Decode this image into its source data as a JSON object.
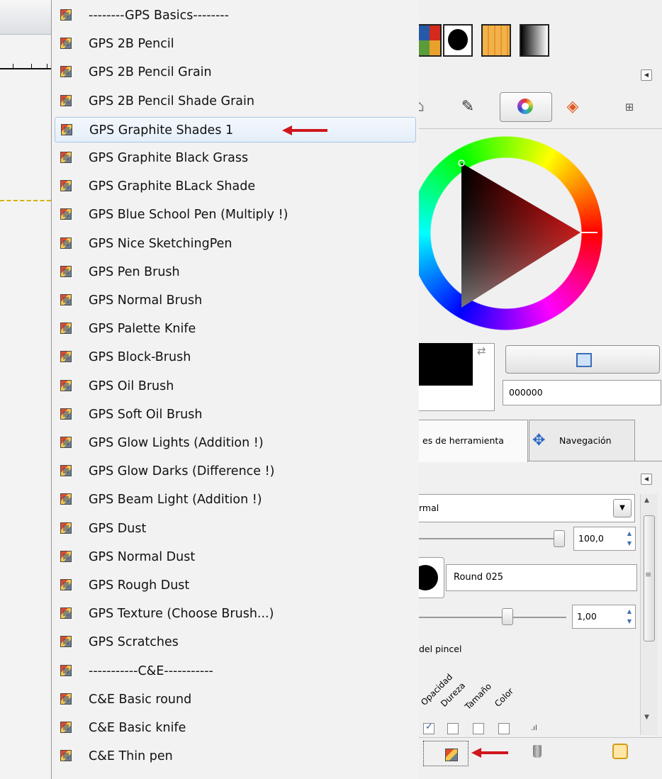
{
  "brush_menu": {
    "items": [
      {
        "label": "--------GPS Basics--------",
        "highlighted": false
      },
      {
        "label": "GPS 2B Pencil",
        "highlighted": false
      },
      {
        "label": "GPS 2B Pencil Grain",
        "highlighted": false
      },
      {
        "label": "GPS 2B Pencil Shade Grain",
        "highlighted": false
      },
      {
        "label": "GPS Graphite Shades 1",
        "highlighted": true
      },
      {
        "label": "GPS Graphite Black Grass",
        "highlighted": false
      },
      {
        "label": "GPS Graphite BLack Shade",
        "highlighted": false
      },
      {
        "label": "GPS Blue School Pen (Multiply !)",
        "highlighted": false
      },
      {
        "label": "GPS Nice SketchingPen",
        "highlighted": false
      },
      {
        "label": "GPS Pen Brush",
        "highlighted": false
      },
      {
        "label": "GPS Normal Brush",
        "highlighted": false
      },
      {
        "label": "GPS Palette Knife",
        "highlighted": false
      },
      {
        "label": "GPS Block-Brush",
        "highlighted": false
      },
      {
        "label": "GPS Oil Brush",
        "highlighted": false
      },
      {
        "label": "GPS Soft Oil Brush",
        "highlighted": false
      },
      {
        "label": "GPS Glow Lights (Addition !)",
        "highlighted": false
      },
      {
        "label": "GPS Glow Darks (Difference !)",
        "highlighted": false
      },
      {
        "label": "GPS Beam Light (Addition !)",
        "highlighted": false
      },
      {
        "label": "GPS Dust",
        "highlighted": false
      },
      {
        "label": "GPS Normal Dust",
        "highlighted": false
      },
      {
        "label": "GPS Rough Dust",
        "highlighted": false
      },
      {
        "label": "GPS Texture (Choose Brush...)",
        "highlighted": false
      },
      {
        "label": "GPS Scratches",
        "highlighted": false
      },
      {
        "label": "-----------C&E-----------",
        "highlighted": false
      },
      {
        "label": "C&E Basic round",
        "highlighted": false
      },
      {
        "label": "C&E Basic knife",
        "highlighted": false
      },
      {
        "label": "C&E Thin pen",
        "highlighted": false
      }
    ]
  },
  "colors": {
    "foreground_hex": "000000",
    "arrow": "#d0161c",
    "highlight_border": "#a9c5e6"
  },
  "tabs": {
    "tool_options": "es de herramienta",
    "navigation": "Navegación"
  },
  "tool_options": {
    "mode": "rmal",
    "opacity": "100,0",
    "brush_name": "Round  025",
    "size": "1,00",
    "dynamics_label": "del pincel",
    "dynamics_columns": [
      "Opacidad",
      "Dureza",
      "Tamaño",
      "Color"
    ]
  },
  "icons": {
    "menu_item": "brush-preset-icon",
    "navigation": "move-arrows-icon",
    "delete": "trash-icon",
    "restore": "restore-icon"
  }
}
